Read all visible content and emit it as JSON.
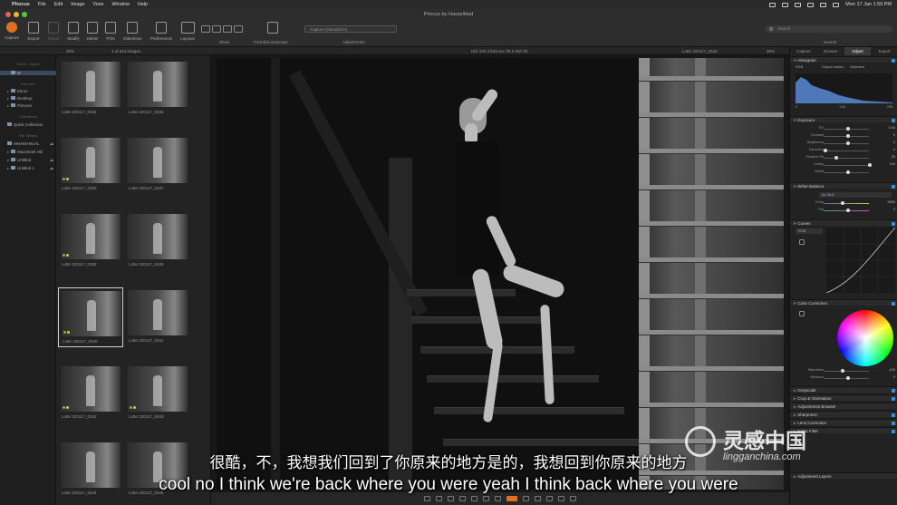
{
  "menubar": {
    "app": "Phocus",
    "items": [
      "File",
      "Edit",
      "Image",
      "View",
      "Window",
      "Help"
    ],
    "clock": "Mon 17 Jan  1:59 PM"
  },
  "window": {
    "title": "Phocus by Hasselblad"
  },
  "toolbar": {
    "buttons": [
      "Capture",
      "Export",
      "Import",
      "Modify",
      "Delete",
      "Print",
      "Slideshow",
      "Preferences",
      "Layouts"
    ],
    "show_label": "Show",
    "orientation_label": "Portrait/Landscape",
    "adjustments_label": "Adjustments",
    "preset": "Capture (Standard+)",
    "search_label": "Search",
    "search_placeholder": "Search"
  },
  "browser_bar": {
    "zoom": "30%",
    "count": "1 of 344 images",
    "exif": "ISO 100   1/160 sec   f/8.0   ISO 80",
    "filename": "Lotte 220117_0340",
    "zoom_right": "39%"
  },
  "left_panel": {
    "header_client": "Client · Digital",
    "header_favorites": "Favorites",
    "header_collections": "Collections",
    "header_filesystem": "File System",
    "items": [
      {
        "label": "BI",
        "selected": true
      },
      {
        "label": "Eleon"
      },
      {
        "label": "Desktop"
      },
      {
        "label": "Pictures"
      },
      {
        "label": "Quick Collection"
      },
      {
        "label": "HMAMANUAL"
      },
      {
        "label": "Macintosh HD"
      },
      {
        "label": "Untitled"
      },
      {
        "label": "Untitled 1"
      }
    ]
  },
  "thumbnails": [
    {
      "name": "Lotte 220117_0334"
    },
    {
      "name": "Lotte 220117_0335"
    },
    {
      "name": "Lotte 220117_0336"
    },
    {
      "name": "Lotte 220117_0337"
    },
    {
      "name": "Lotte 220117_0338"
    },
    {
      "name": "Lotte 220117_0339"
    },
    {
      "name": "Lotte 220117_0340"
    },
    {
      "name": "Lotte 220117_0341"
    },
    {
      "name": "Lotte 220117_0342"
    },
    {
      "name": "Lotte 220117_0343"
    },
    {
      "name": "Lotte 220117_0344"
    },
    {
      "name": "Lotte 220117_0345"
    }
  ],
  "selected_thumbnail": 6,
  "right_panel": {
    "tabs": [
      "Capture",
      "Browse",
      "Adjust",
      "Export"
    ],
    "active_tab": "Adjust",
    "sections": {
      "histogram": "Histogram",
      "histogram_mode": "RGB",
      "hist_output_label": "Output values",
      "hist_clip_label": "Clipboard",
      "hist_ticks": [
        "0",
        "1.00",
        "255"
      ],
      "exposure": "Exposure",
      "white_balance": "White Balance",
      "curves": "Curves",
      "color_correction": "Color Correction",
      "grayscale": "Grayscale",
      "crop": "Crop & Orientation",
      "adjustments_browser": "Adjustments Browser",
      "sharpness": "Sharpness",
      "lens": "Lens Correction",
      "noise": "Noise Filter",
      "adjustment_layers": "Adjustment Layers"
    },
    "exposure_sliders": [
      {
        "label": "EV",
        "value": "0.00"
      },
      {
        "label": "Contrast",
        "value": "0"
      },
      {
        "label": "Brightness",
        "value": "0"
      },
      {
        "label": "Recovery",
        "value": "0"
      },
      {
        "label": "Shadow Fill",
        "value": "25"
      },
      {
        "label": "Clarity",
        "value": "100"
      },
      {
        "label": "Detail",
        "value": ""
      }
    ],
    "wb_preset": "As Shot",
    "wb_sliders": [
      {
        "label": "Temp",
        "value": "5500"
      },
      {
        "label": "Tint",
        "value": "0"
      }
    ],
    "curves_channel": "RGB",
    "cc_sliders": [
      {
        "label": "Saturation",
        "value": "-100"
      },
      {
        "label": "Vibrance",
        "value": "0"
      }
    ]
  },
  "subtitles": {
    "zh": "很酷，不，我想我们回到了你原来的地方是的，我想回到你原来的地方",
    "en": "cool no I think we're back where you were yeah I think back where you were"
  },
  "watermark": {
    "name": "灵感中国",
    "url": "lingganchina.com"
  },
  "colors": {
    "accent": "#e07020",
    "selection": "#3a4a5e",
    "check": "#3b8de0",
    "green_dot": "#7bbf3a",
    "yellow_dot": "#d9c93a"
  }
}
